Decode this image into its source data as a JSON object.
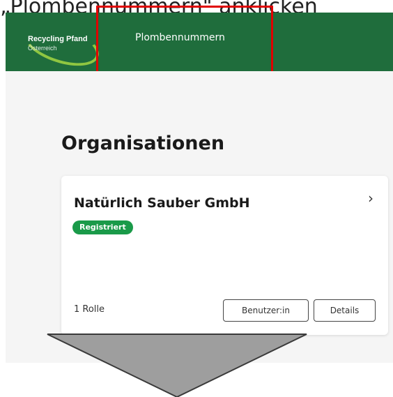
{
  "instruction": {
    "caption": "„Plombennummern\" anklicken"
  },
  "header": {
    "logo_title": "Recycling Pfand",
    "logo_subtitle": "Österreich",
    "nav_link": "Plombennummern",
    "background_color": "#1f6d3c",
    "logo_accent_color": "#8fc641"
  },
  "highlight": {
    "color": "#e00000"
  },
  "main": {
    "page_title": "Organisationen",
    "organization_card": {
      "name": "Natürlich Sauber GmbH",
      "status_badge": "Registriert",
      "status_color": "#1a9a49",
      "roles": "1 Rolle",
      "users_button": "Benutzer:in",
      "details_button": "Details",
      "chevron_icon": "chevron-right-icon"
    }
  }
}
